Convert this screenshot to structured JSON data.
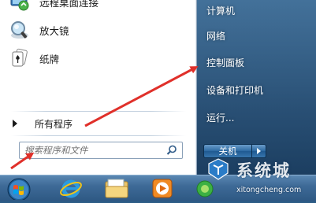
{
  "left_panel": {
    "programs": [
      {
        "label": "远程桌面连接",
        "icon": "remote-desktop-icon"
      },
      {
        "label": "放大镜",
        "icon": "magnifier-icon"
      },
      {
        "label": "纸牌",
        "icon": "solitaire-icon"
      }
    ],
    "all_programs_label": "所有程序",
    "search": {
      "placeholder": "搜索程序和文件",
      "icon": "search-icon"
    }
  },
  "right_panel": {
    "items": [
      {
        "label": "计算机"
      },
      {
        "label": "网络"
      },
      {
        "label": "控制面板"
      },
      {
        "label": "设备和打印机"
      },
      {
        "label": "运行..."
      }
    ],
    "shutdown_label": "关机",
    "shutdown_options_icon": "triangle-right-icon"
  },
  "taskbar": {
    "buttons": [
      {
        "name": "start-orb",
        "icon": "windows-orb-icon"
      },
      {
        "name": "internet-explorer",
        "icon": "ie-icon"
      },
      {
        "name": "windows-explorer",
        "icon": "folder-icon"
      },
      {
        "name": "media-player",
        "icon": "media-player-icon"
      },
      {
        "name": "extra-app",
        "icon": "green-app-icon"
      }
    ]
  },
  "watermark": {
    "brand": "系统城",
    "url": "xitongcheng.com"
  },
  "colors": {
    "annotation_red": "#e0302a",
    "highlight_blue": "#3b7fc4"
  }
}
